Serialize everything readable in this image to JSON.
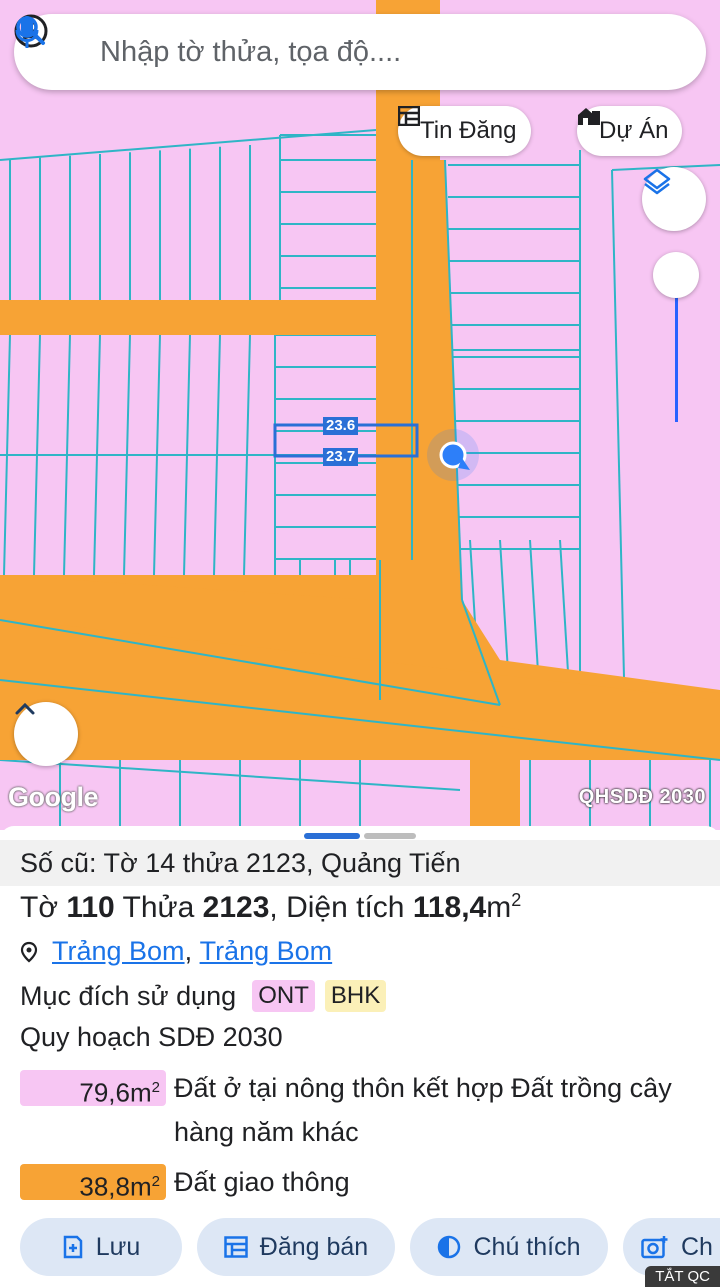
{
  "search": {
    "placeholder": "Nhập tờ thửa, tọa độ....",
    "account_icon": "account-circle-icon",
    "search_icon": "search-icon",
    "mic_icon": "microphone-icon"
  },
  "chips": {
    "listings_label": "Tin Đăng",
    "projects_label": "Dự Án"
  },
  "map": {
    "layers_icon": "layers-icon",
    "zoom_level_fraction": 0.0,
    "google_label": "Google",
    "layer_name": "QHSDĐ 2030",
    "dim_top": "23.6",
    "dim_bottom": "23.7",
    "colors": {
      "residential": "#f7c6f3",
      "road": "#f7a335",
      "parcel_line": "#2fb5c6",
      "location": "#2d7ff9"
    }
  },
  "sheet": {
    "old_info": "Số cũ: Tờ 14 thửa 2123, Quảng Tiến",
    "title": {
      "sheet_prefix": "Tờ ",
      "sheet_no": "110",
      "parcel_prefix": " Thửa ",
      "parcel_no": "2123",
      "area_prefix": ", Diện tích ",
      "area_value": "118,4",
      "area_unit": "m",
      "area_exp": "2"
    },
    "location": {
      "district": "Trảng Bom",
      "separator": ", ",
      "province": "Trảng Bom"
    },
    "purpose_label": "Mục đích sử dụng",
    "purpose_tags": [
      {
        "code": "ONT",
        "color": "#f7c6f3"
      },
      {
        "code": "BHK",
        "color": "#fbf0b8"
      }
    ],
    "plan_title": "Quy hoạch SDĐ 2030",
    "plan_items": [
      {
        "area": "79,6m",
        "exp": "2",
        "desc": "Đất ở tại nông thôn kết hợp Đất trồng cây hàng năm khác",
        "color": "#f7c6f3"
      },
      {
        "area": "38,8m",
        "exp": "2",
        "desc": "Đất giao thông",
        "color": "#f7a335"
      }
    ],
    "actions": [
      {
        "label": "Lưu",
        "icon": "bookmark-add-icon"
      },
      {
        "label": "Đăng bán",
        "icon": "listing-icon"
      },
      {
        "label": "Chú thích",
        "icon": "contrast-icon"
      },
      {
        "label": "Ch",
        "icon": "add-photo-icon"
      }
    ],
    "ad_label": "TẮT QC"
  }
}
